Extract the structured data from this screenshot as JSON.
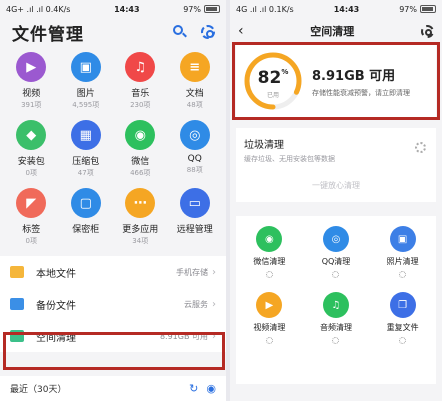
{
  "left": {
    "status": {
      "carrier": "4G+ .ıl .ıl 0.4K/s",
      "time": "14:43",
      "battery": "97%"
    },
    "title": "文件管理",
    "icons": {
      "search": "search-icon",
      "settings": "gear-icon"
    },
    "categories": [
      {
        "name": "视频",
        "count": "391项",
        "color": "#9b59d0",
        "glyph": "▶"
      },
      {
        "name": "图片",
        "count": "4,595项",
        "color": "#2f8be6",
        "glyph": "▣"
      },
      {
        "name": "音乐",
        "count": "230项",
        "color": "#f04848",
        "glyph": "♫"
      },
      {
        "name": "文档",
        "count": "48项",
        "color": "#f5a623",
        "glyph": "≡"
      },
      {
        "name": "安装包",
        "count": "0项",
        "color": "#3bbf6a",
        "glyph": "◆"
      },
      {
        "name": "压缩包",
        "count": "47项",
        "color": "#3d6fe6",
        "glyph": "▦"
      },
      {
        "name": "微信",
        "count": "466项",
        "color": "#2dc05e",
        "glyph": "◉"
      },
      {
        "name": "QQ",
        "count": "88项",
        "color": "#2f8be6",
        "glyph": "◎"
      },
      {
        "name": "标签",
        "count": "0项",
        "color": "#f06a5a",
        "glyph": "◤"
      },
      {
        "name": "保密柜",
        "count": "",
        "color": "#2f8be6",
        "glyph": "▢"
      },
      {
        "name": "更多应用",
        "count": "34项",
        "color": "#f5a623",
        "glyph": "⋯"
      },
      {
        "name": "远程管理",
        "count": "",
        "color": "#3d6fe6",
        "glyph": "▭"
      }
    ],
    "list": [
      {
        "label": "本地文件",
        "value": "手机存储",
        "color": "#f5b63b"
      },
      {
        "label": "备份文件",
        "value": "云服务",
        "color": "#3b8fe6"
      },
      {
        "label": "空间清理",
        "value": "8.91GB 可用",
        "color": "#3cc08a"
      }
    ],
    "recent": "最近（30天）",
    "chevron": "›"
  },
  "right": {
    "status": {
      "carrier": "4G .ıl .ıl 0.1K/s",
      "time": "14:43",
      "battery": "97%"
    },
    "back": "‹",
    "title": "空间清理",
    "storage": {
      "percent": 82,
      "percent_text": "82",
      "pct_sign": "%",
      "sub": "已用",
      "size": "8.91GB 可用",
      "hint": "存储性能衰减预警，请立即清理",
      "ring_color": "#f5a623"
    },
    "junk": {
      "title": "垃圾清理",
      "desc": "缓存垃圾、无用安装包等数据",
      "button": "一键放心清理"
    },
    "tools": [
      {
        "name": "微信清理",
        "color": "#2dc05e",
        "glyph": "◉"
      },
      {
        "name": "QQ清理",
        "color": "#2f8be6",
        "glyph": "◎"
      },
      {
        "name": "照片清理",
        "color": "#3d7fe6",
        "glyph": "▣"
      },
      {
        "name": "视频清理",
        "color": "#f5a623",
        "glyph": "▶"
      },
      {
        "name": "音频清理",
        "color": "#2dc05e",
        "glyph": "♫"
      },
      {
        "name": "重复文件",
        "color": "#3d6fe6",
        "glyph": "❐"
      }
    ]
  },
  "colors": {
    "highlight": "#b52a24",
    "accent": "#2a6fe0"
  }
}
